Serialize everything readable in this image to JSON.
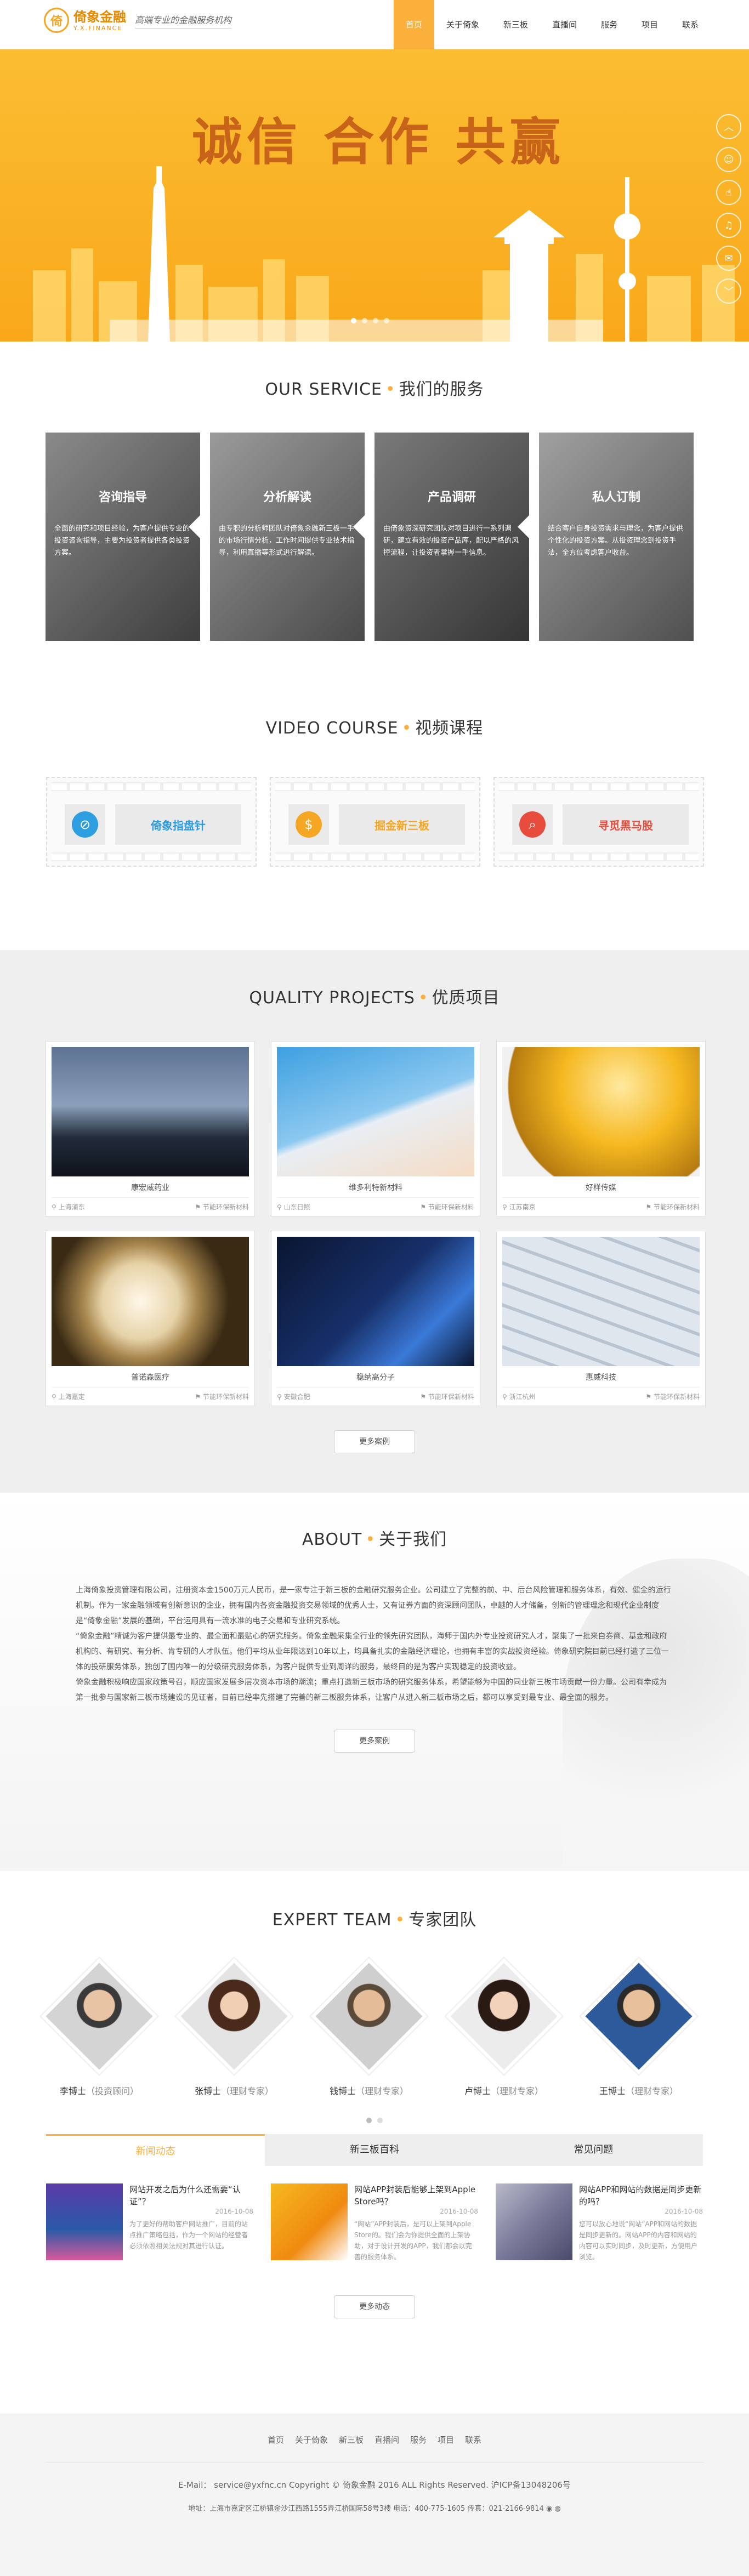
{
  "header": {
    "logo_mark": "倚",
    "logo_cn": "倚象金融",
    "logo_en": "Y.X.FINANCE",
    "slogan": "高端专业的金融服务机构",
    "nav": [
      "首页",
      "关于倚象",
      "新三板",
      "直播间",
      "服务",
      "项目",
      "联系"
    ]
  },
  "banner": {
    "slogan": "诚信 合作 共赢",
    "side_icons": [
      "chevron-up-icon",
      "chat-icon",
      "hand-icon",
      "bell-icon",
      "message-icon",
      "chevron-down-icon"
    ]
  },
  "service": {
    "title_en": "OUR SERVICE",
    "title_cn": "我们的服务",
    "cards": [
      {
        "title": "咨询指导",
        "text": "全面的研究和项目经验，为客户提供专业的投资咨询指导，主要为投资者提供各类投资方案。"
      },
      {
        "title": "分析解读",
        "text": "由专职的分析师团队对倚象金融新三板一手的市场行情分析，工作时间提供专业技术指导，利用直播等形式进行解读。"
      },
      {
        "title": "产品调研",
        "text": "由倚象资深研究团队对项目进行一系列调研，建立有效的投资产品库，配以严格的风控流程，让投资者掌握一手信息。"
      },
      {
        "title": "私人订制",
        "text": "结合客户自身投资需求与理念，为客户提供个性化的投资方案。从投资理念到投资手法，全方位考虑客户收益。"
      }
    ]
  },
  "video": {
    "title_en": "VIDEO COURSE",
    "title_cn": "视频课程",
    "cards": [
      {
        "label": "倚象指盘针",
        "icon": "compass-icon",
        "color": "#2d9ee0"
      },
      {
        "label": "掘金新三板",
        "icon": "money-bag-icon",
        "color": "#f5a623"
      },
      {
        "label": "寻觅黑马股",
        "icon": "search-icon",
        "color": "#e84c3d"
      }
    ]
  },
  "projects": {
    "title_en": "QUALITY PROJECTS",
    "title_cn": "优质项目",
    "items": [
      {
        "name": "康宏威药业",
        "loc": "上海浦东",
        "cat": "节能环保新材料"
      },
      {
        "name": "维多利特新材料",
        "loc": "山东日照",
        "cat": "节能环保新材料"
      },
      {
        "name": "好样传媒",
        "loc": "江苏南京",
        "cat": "节能环保新材料"
      },
      {
        "name": "普诺森医疗",
        "loc": "上海嘉定",
        "cat": "节能环保新材料"
      },
      {
        "name": "稳纳高分子",
        "loc": "安徽合肥",
        "cat": "节能环保新材料"
      },
      {
        "name": "惠威科技",
        "loc": "浙江杭州",
        "cat": "节能环保新材料"
      }
    ],
    "more": "更多案例"
  },
  "about": {
    "title_en": "ABOUT",
    "title_cn": "关于我们",
    "paras": [
      "上海倚象投资管理有限公司，注册资本金1500万元人民币，是一家专注于新三板的金融研究服务企业。公司建立了完整的前、中、后台风险管理和服务体系，有效、健全的运行机制。作为一家金融领域有创新意识的企业，拥有国内各资金融投资交易领域的优秀人士，又有证券方面的资深顾问团队，卓越的人才储备，创新的管理理念和现代企业制度是“倚象金融”发展的基础，平台运用具有一流水准的电子交易和专业研究系统。",
      "“倚象金融”精诚为客户提供最专业的、最全面和最贴心的研究服务。倚象金融采集全行业的领先研究团队，海师于国内外专业投资研究人才，聚集了一批来自券商、基金和政府机构的、有研究、有分析、肯专研的人才队伍。他们平均从业年限达到10年以上，均具备扎实的金融经济理论，也拥有丰富的实战投资经验。倚象研究院目前已经打造了三位一体的投研服务体系，独创了国内唯一的分级研究服务体系，为客户提供专业到周详的服务，最终目的是为客户实现稳定的投资收益。",
      "倚象金融积极响应国家政策号召，顺应国家发展多层次资本市场的潮流；重点打造新三板市场的研究服务体系，希望能够为中国的同业新三板市场贡献一份力量。公司有幸成为第一批参与国家新三板市场建设的见证者，目前已经率先搭建了完善的新三板服务体系，让客户从进入新三板市场之后，都可以享受到最专业、最全面的服务。"
    ],
    "more": "更多案例"
  },
  "team": {
    "title_en": "EXPERT TEAM",
    "title_cn": "专家团队",
    "members": [
      {
        "name": "李博士",
        "role": "（投资顾问）"
      },
      {
        "name": "张博士",
        "role": "（理财专家）"
      },
      {
        "name": "钱博士",
        "role": "（理财专家）"
      },
      {
        "name": "卢博士",
        "role": "（理财专家）"
      },
      {
        "name": "王博士",
        "role": "（理财专家）"
      }
    ]
  },
  "news": {
    "tabs": [
      "新闻动态",
      "新三板百科",
      "常见问题"
    ],
    "items": [
      {
        "title": "网站开发之后为什么还需要“认证”？",
        "date": "2016-10-08",
        "text": "为了更好的帮助客户网站推广，目前的站点推广策略包括，作为一个网站的经营者必须依照相关法规对其进行认证。"
      },
      {
        "title": "网站APP封装后能够上架到Apple Store吗？",
        "date": "2016-10-08",
        "text": "“网站”APP封装后，是可以上架到Apple Store的。我们会为你提供全面的上架协助，对于设计开发的APP，我们都会以完善的服务体系。"
      },
      {
        "title": "网站APP和网站的数据是同步更新的吗？",
        "date": "2016-10-08",
        "text": "您可以放心地说“网站”APP和网站的数据是同步更新的。网站APP的内容和网站的内容可以实时同步，及时更新，方便用户浏览。"
      }
    ],
    "more": "更多动态"
  },
  "footer": {
    "nav": [
      "首页",
      "关于倚象",
      "新三板",
      "直播间",
      "服务",
      "项目",
      "联系"
    ],
    "line1": "E-Mail： service@yxfnc.cn  Copyright © 倚象金融 2016 ALL Rights Reserved. 沪ICP备13048206号",
    "line2": "地址：上海市嘉定区江桥镇金沙江西路1555弄江桥国际58号3楼  电话：400-775-1605  传真：021-2166-9814"
  }
}
